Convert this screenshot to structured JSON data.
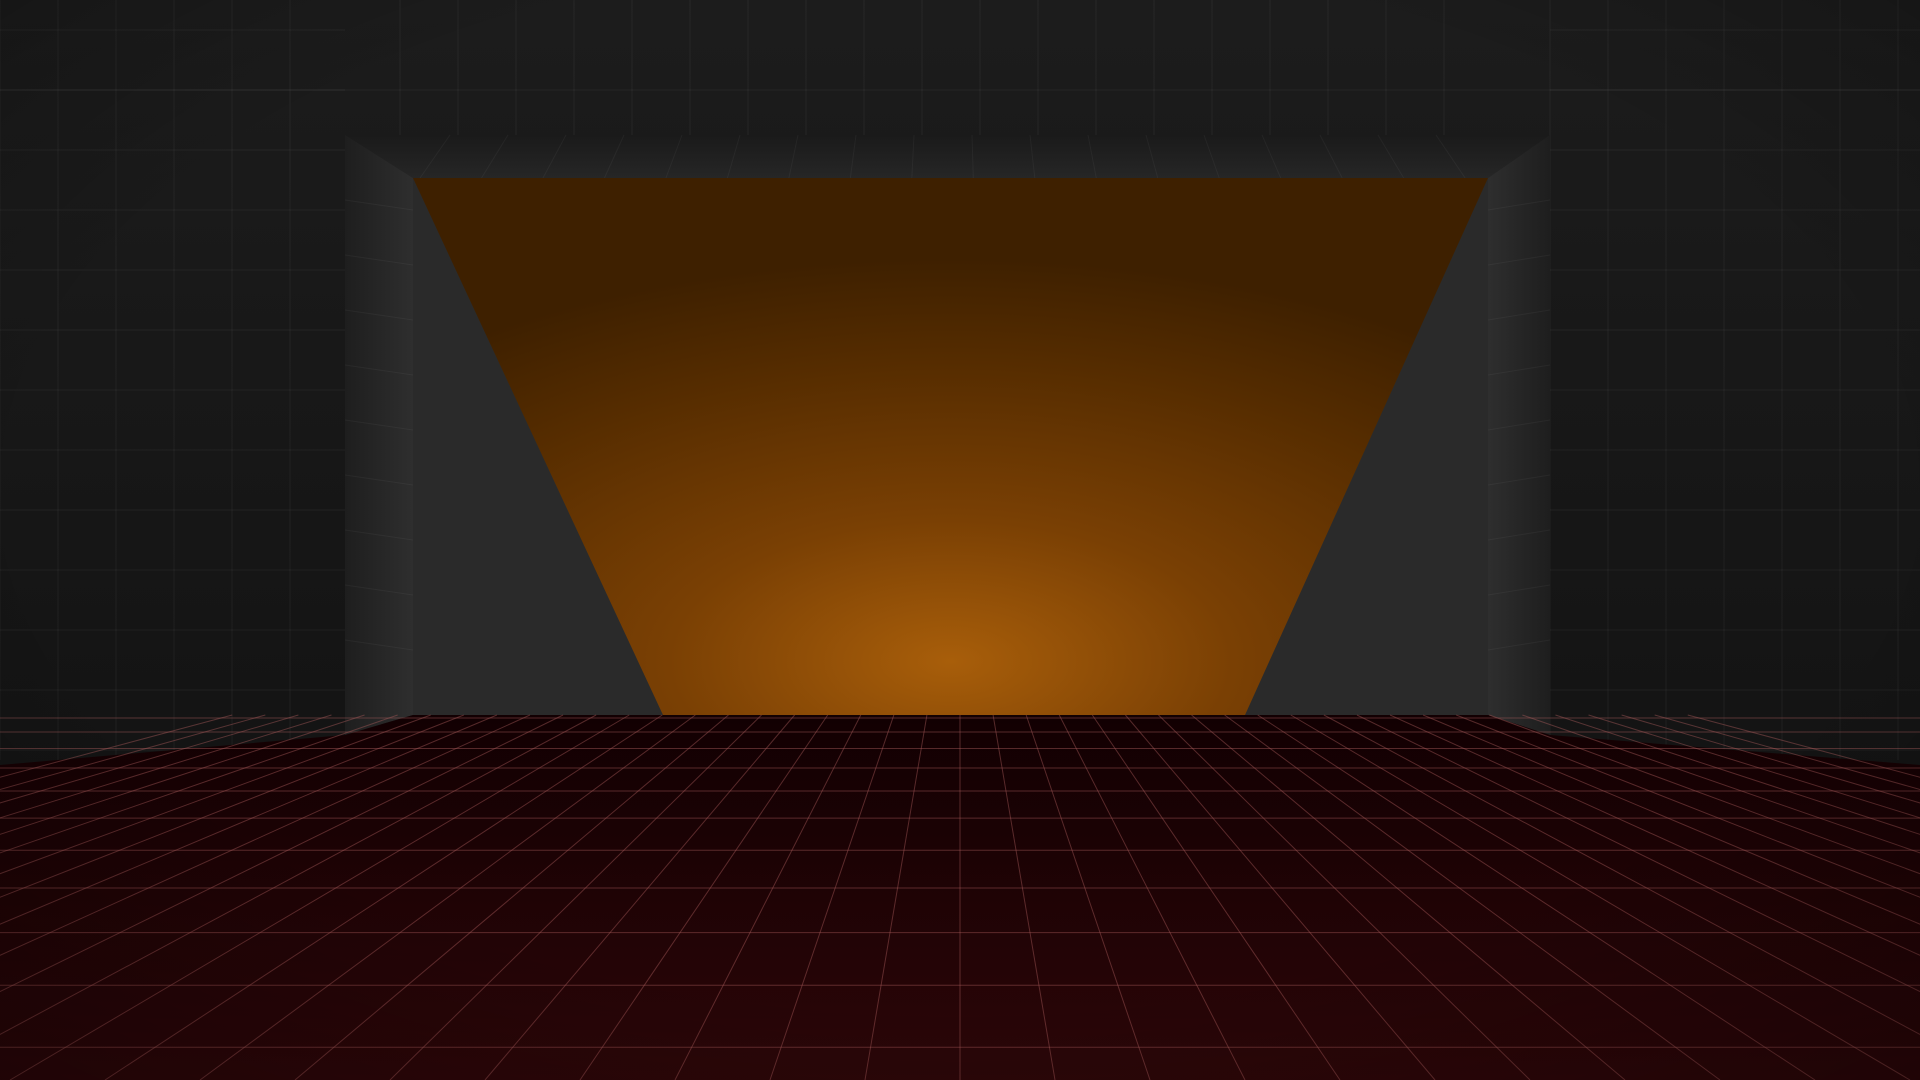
{
  "scene": {
    "kind": "3d-room-viewport",
    "colors": {
      "background": "#111111",
      "wall_dark": "#161616",
      "wall_mid": "#222222",
      "alcove_side": "#2b2b2b",
      "back_panel_top": "#4a2700",
      "back_panel_glow": "#a05a08",
      "floor_near": "#2a0506",
      "floor_far": "#130002",
      "grid_wall": "#3a3a3a",
      "grid_floor": "#7a3a3a"
    }
  }
}
